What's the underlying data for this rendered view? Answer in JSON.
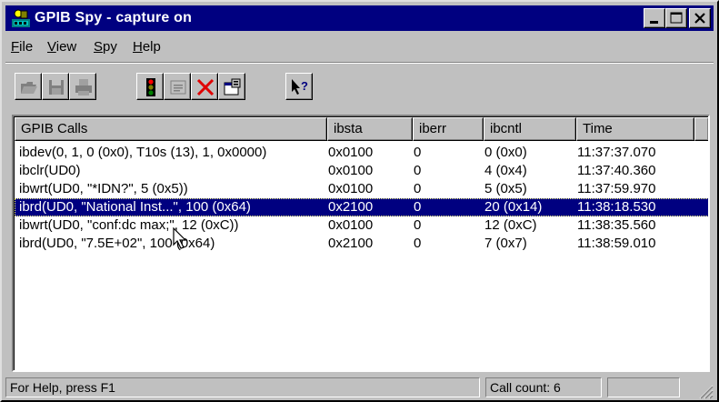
{
  "window": {
    "title": "GPIB Spy - capture on",
    "app_icon": "gpib-app-icon"
  },
  "title_buttons": [
    "minimize-icon",
    "maximize-icon",
    "close-icon"
  ],
  "menu": {
    "items": [
      {
        "underline": "F",
        "rest": "ile"
      },
      {
        "underline": "V",
        "rest": "iew"
      },
      {
        "underline": "S",
        "rest": "py"
      },
      {
        "underline": "H",
        "rest": "elp"
      }
    ]
  },
  "toolbar": {
    "buttons": [
      "open-icon",
      "save-icon",
      "print-icon",
      "capture-traffic-light-icon",
      "properties-icon",
      "clear-icon",
      "settings-icon",
      "context-help-icon"
    ]
  },
  "table": {
    "columns": [
      "GPIB Calls",
      "ibsta",
      "iberr",
      "ibcntl",
      "Time"
    ],
    "rows": [
      [
        "ibdev(0, 1, 0 (0x0), T10s (13), 1, 0x0000)",
        "0x0100",
        "0",
        "0 (0x0)",
        "11:37:37.070"
      ],
      [
        "ibclr(UD0)",
        "0x0100",
        "0",
        "4 (0x4)",
        "11:37:40.360"
      ],
      [
        "ibwrt(UD0, \"*IDN?\", 5 (0x5))",
        "0x0100",
        "0",
        "5 (0x5)",
        "11:37:59.970"
      ],
      [
        "ibrd(UD0, \"National Inst...\", 100 (0x64)",
        "0x2100",
        "0",
        "20 (0x14)",
        "11:38:18.530"
      ],
      [
        "ibwrt(UD0, \"conf:dc max;\", 12 (0xC))",
        "0x0100",
        "0",
        "12 (0xC)",
        "11:38:35.560"
      ],
      [
        "ibrd(UD0, \"7.5E+02\", 100 (0x64)",
        "0x2100",
        "0",
        "7 (0x7)",
        "11:38:59.010"
      ]
    ],
    "selected_row": 3
  },
  "status": {
    "help": "For Help, press F1",
    "call_count": "Call count:  6"
  },
  "colors": {
    "titlebar": "#000080",
    "selection": "#000080",
    "face": "#c0c0c0"
  }
}
